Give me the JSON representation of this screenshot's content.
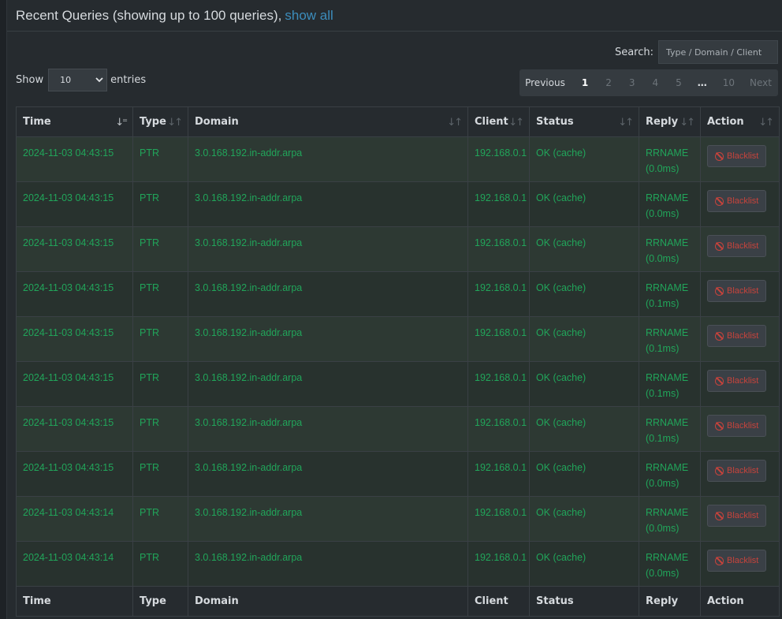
{
  "header": {
    "title": "Recent Queries (showing up to 100 queries),",
    "show_all": "show all"
  },
  "search": {
    "label": "Search:",
    "placeholder": "Type / Domain / Client"
  },
  "length": {
    "show": "Show",
    "value": "10",
    "entries": "entries"
  },
  "pagination": {
    "previous": "Previous",
    "pages": [
      "1",
      "2",
      "3",
      "4",
      "5"
    ],
    "ellipsis": "…",
    "last": "10",
    "next": "Next"
  },
  "columns": [
    "Time",
    "Type",
    "Domain",
    "Client",
    "Status",
    "Reply",
    "Action"
  ],
  "rows": [
    {
      "time": "2024-11-03 04:43:15",
      "type": "PTR",
      "domain": "3.0.168.192.in-addr.arpa",
      "client": "192.168.0.1",
      "status": "OK (cache)",
      "reply": "RRNAME (0.0ms)",
      "action": "Blacklist"
    },
    {
      "time": "2024-11-03 04:43:15",
      "type": "PTR",
      "domain": "3.0.168.192.in-addr.arpa",
      "client": "192.168.0.1",
      "status": "OK (cache)",
      "reply": "RRNAME (0.0ms)",
      "action": "Blacklist"
    },
    {
      "time": "2024-11-03 04:43:15",
      "type": "PTR",
      "domain": "3.0.168.192.in-addr.arpa",
      "client": "192.168.0.1",
      "status": "OK (cache)",
      "reply": "RRNAME (0.0ms)",
      "action": "Blacklist"
    },
    {
      "time": "2024-11-03 04:43:15",
      "type": "PTR",
      "domain": "3.0.168.192.in-addr.arpa",
      "client": "192.168.0.1",
      "status": "OK (cache)",
      "reply": "RRNAME (0.1ms)",
      "action": "Blacklist"
    },
    {
      "time": "2024-11-03 04:43:15",
      "type": "PTR",
      "domain": "3.0.168.192.in-addr.arpa",
      "client": "192.168.0.1",
      "status": "OK (cache)",
      "reply": "RRNAME (0.1ms)",
      "action": "Blacklist"
    },
    {
      "time": "2024-11-03 04:43:15",
      "type": "PTR",
      "domain": "3.0.168.192.in-addr.arpa",
      "client": "192.168.0.1",
      "status": "OK (cache)",
      "reply": "RRNAME (0.1ms)",
      "action": "Blacklist"
    },
    {
      "time": "2024-11-03 04:43:15",
      "type": "PTR",
      "domain": "3.0.168.192.in-addr.arpa",
      "client": "192.168.0.1",
      "status": "OK (cache)",
      "reply": "RRNAME (0.1ms)",
      "action": "Blacklist"
    },
    {
      "time": "2024-11-03 04:43:15",
      "type": "PTR",
      "domain": "3.0.168.192.in-addr.arpa",
      "client": "192.168.0.1",
      "status": "OK (cache)",
      "reply": "RRNAME (0.0ms)",
      "action": "Blacklist"
    },
    {
      "time": "2024-11-03 04:43:14",
      "type": "PTR",
      "domain": "3.0.168.192.in-addr.arpa",
      "client": "192.168.0.1",
      "status": "OK (cache)",
      "reply": "RRNAME (0.0ms)",
      "action": "Blacklist"
    },
    {
      "time": "2024-11-03 04:43:14",
      "type": "PTR",
      "domain": "3.0.168.192.in-addr.arpa",
      "client": "192.168.0.1",
      "status": "OK (cache)",
      "reply": "RRNAME (0.0ms)",
      "action": "Blacklist"
    }
  ],
  "icons": {
    "sort_active": "sort-amount-desc-icon",
    "sort": "sort-icon",
    "blacklist": "ban-icon",
    "select": "chevron-down-icon"
  },
  "colors": {
    "background": "#262b2f",
    "link": "#3c8dbc",
    "row_text": "#21a55a",
    "blacklist_text": "#c7433c"
  }
}
